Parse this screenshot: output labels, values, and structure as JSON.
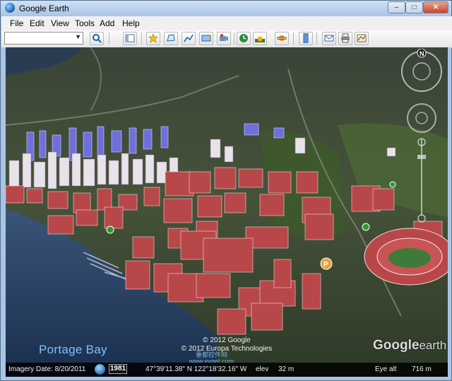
{
  "window": {
    "title": "Google Earth",
    "minimize_label": "–",
    "maximize_label": "□",
    "close_label": "✕"
  },
  "menu": [
    "File",
    "Edit",
    "View",
    "Tools",
    "Add",
    "Help"
  ],
  "search": {
    "value": "",
    "placeholder": ""
  },
  "toolbar_icons": [
    "search-icon",
    "sidebar-toggle-icon",
    "add-placemark-icon",
    "add-polygon-icon",
    "add-path-icon",
    "add-image-overlay-icon",
    "record-tour-icon",
    "historical-imagery-icon",
    "sunlight-icon",
    "planets-icon",
    "ruler-icon",
    "email-icon",
    "print-icon",
    "view-in-maps-icon"
  ],
  "map": {
    "place_label": "Portage Bay",
    "copyright": [
      "© 2012 Google",
      "© 2012 Europa Technologies"
    ],
    "logo": {
      "part1": "Google",
      "part2": "earth"
    },
    "watermark": [
      "重都控件网",
      "www.evget.com"
    ],
    "poi_label": "P",
    "compass_label": "N"
  },
  "status": {
    "imagery_date": "Imagery Date: 8/20/2011",
    "year": "1981",
    "coordinates": "47°39'11.38\" N 122°18'32.16\" W",
    "elev_label": "elev",
    "elev_value": "32 m",
    "eye_alt_label": "Eye alt",
    "eye_alt_value": "716 m"
  },
  "colors": {
    "water": "#233a5c",
    "buildings_red": "#b53a3a",
    "buildings_blue": "#6b6bd8",
    "label_blue": "#7cc2ff"
  }
}
